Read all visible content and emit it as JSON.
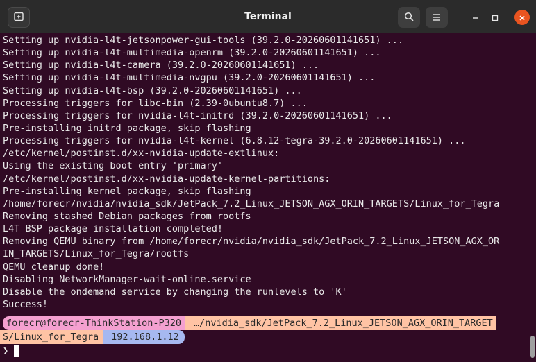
{
  "window": {
    "title": "Terminal"
  },
  "titlebar": {
    "new_tab_icon": "new-tab-icon",
    "search_icon": "search-icon",
    "menu_icon": "hamburger-menu-icon",
    "minimize_icon": "minimize-icon",
    "maximize_icon": "maximize-icon",
    "close_icon": "close-icon",
    "close_color": "#e95420"
  },
  "terminal": {
    "background": "#300a24",
    "lines": [
      "Setting up nvidia-l4t-jetsonpower-gui-tools (39.2.0-20260601141651) ...",
      "Setting up nvidia-l4t-multimedia-openrm (39.2.0-20260601141651) ...",
      "Setting up nvidia-l4t-camera (39.2.0-20260601141651) ...",
      "Setting up nvidia-l4t-multimedia-nvgpu (39.2.0-20260601141651) ...",
      "Setting up nvidia-l4t-bsp (39.2.0-20260601141651) ...",
      "Processing triggers for libc-bin (2.39-0ubuntu8.7) ...",
      "Processing triggers for nvidia-l4t-initrd (39.2.0-20260601141651) ...",
      "Pre-installing initrd package, skip flashing",
      "Processing triggers for nvidia-l4t-kernel (6.8.12-tegra-39.2.0-20260601141651) ...",
      "/etc/kernel/postinst.d/xx-nvidia-update-extlinux:",
      "Using the existing boot entry 'primary'",
      "/etc/kernel/postinst.d/xx-nvidia-update-kernel-partitions:",
      "Pre-installing kernel package, skip flashing",
      "/home/forecr/nvidia/nvidia_sdk/JetPack_7.2_Linux_JETSON_AGX_ORIN_TARGETS/Linux_for_Tegra",
      "Removing stashed Debian packages from rootfs",
      "L4T BSP package installation completed!",
      "Removing QEMU binary from /home/forecr/nvidia/nvidia_sdk/JetPack_7.2_Linux_JETSON_AGX_OR",
      "IN_TARGETS/Linux_for_Tegra/rootfs",
      "QEMU cleanup done!",
      "Disabling NetworkManager-wait-online.service",
      "Disable the ondemand service by changing the runlevels to 'K'",
      "Success!"
    ],
    "prompt": {
      "user_host": "forecr@forecr-ThinkStation-P320",
      "path_part1": "…/nvidia_sdk/JetPack_7.2_Linux_JETSON_AGX_ORIN_TARGET",
      "path_part2": "S/Linux_for_Tegra",
      "ip": "192.168.1.12",
      "prompt_symbol": "❯",
      "user_color": "#f4a0d0",
      "path_color": "#ffc3a4",
      "ip_color": "#a6b8f0"
    }
  }
}
